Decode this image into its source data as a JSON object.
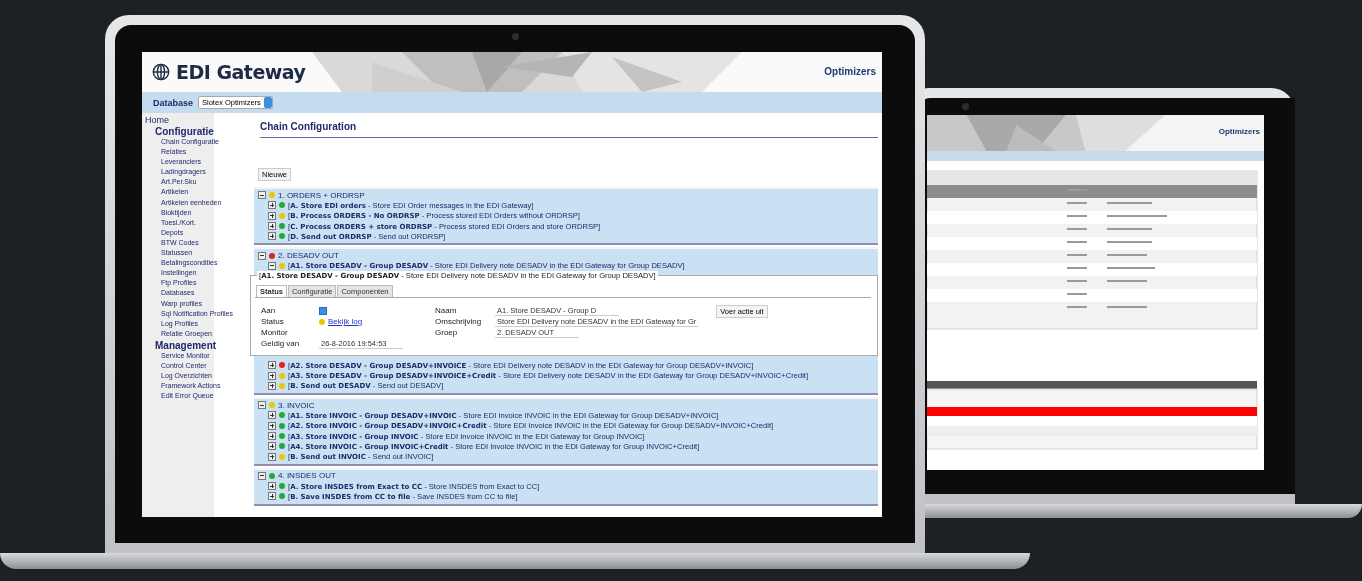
{
  "header": {
    "title": "EDI Gateway",
    "logo": "Optimizers"
  },
  "database": {
    "label": "Database",
    "value": "Slotex Optimizers"
  },
  "sidebar": {
    "items": [
      {
        "label": "Home",
        "kind": "link"
      },
      {
        "label": "Configuratie",
        "kind": "heading",
        "children": [
          {
            "label": "Chain Configuratie"
          },
          {
            "label": "Relaties"
          },
          {
            "label": "Leveranciers"
          },
          {
            "label": "Ladingdragers"
          },
          {
            "label": "Art.Per.Sku"
          },
          {
            "label": "Artikelen"
          },
          {
            "label": "Artikelen eenheden"
          },
          {
            "label": "Bloktijden"
          },
          {
            "label": "Toesl./Kort."
          },
          {
            "label": "Depots"
          },
          {
            "label": "BTW Codes"
          },
          {
            "label": "Statussen"
          },
          {
            "label": "Betalingscondities"
          },
          {
            "label": "Instellingen"
          },
          {
            "label": "Ftp Profiles"
          },
          {
            "label": "Databases"
          },
          {
            "label": "Warp profiles"
          },
          {
            "label": "Sql Notification Profiles"
          },
          {
            "label": "Log Profiles"
          },
          {
            "label": "Relatie Groepen"
          }
        ]
      },
      {
        "label": "Management",
        "kind": "heading",
        "children": [
          {
            "label": "Service Monitor"
          },
          {
            "label": "Control Center"
          },
          {
            "label": "Log Overzichten"
          },
          {
            "label": "Framework Actions"
          },
          {
            "label": "Edit Error Queue"
          }
        ]
      }
    ]
  },
  "main": {
    "title": "Chain Configuration",
    "new_button": "Nieuwe",
    "groups": [
      {
        "name": "1. ORDERS + ORDRSP",
        "color": "#e8c800",
        "expanded": true,
        "steps": [
          {
            "text": "[**A. Store EDI orders** - Store EDI Order messages in the EDI Gateway]",
            "color": "#22aa33",
            "expanded": false
          },
          {
            "text": "[**B. Process ORDERS - No ORDRSP** - Process stored EDI Orders without ORDRSP]",
            "color": "#e8c800",
            "expanded": false
          },
          {
            "text": "[**C. Process ORDERS + store ORDRSP** - Process stored EDI Orders and store ORDRSP]",
            "color": "#22aa33",
            "expanded": false
          },
          {
            "text": "[**D. Send out ORDRSP** - Send out ORDRSP]",
            "color": "#22aa33",
            "expanded": false
          }
        ]
      },
      {
        "name": "2. DESADV OUT",
        "color": "#dd2222",
        "expanded": true,
        "steps": [
          {
            "text": "[**A1. Store DESADV - Group DESADV** - Store EDI Delivery note DESADV in the EDI Gateway for Group DESADV]",
            "color": "#e8c800",
            "expanded": true,
            "detail": {
              "legend": "[**A1. Store DESADV - Group DESADV** - Store EDI Delivery note DESADV in the EDI Gateway for Group DESADV]",
              "tabs": [
                {
                  "label": "Status",
                  "selected": true
                },
                {
                  "label": "Configuratie",
                  "selected": false
                },
                {
                  "label": "Componenten",
                  "selected": false
                }
              ],
              "aan": {
                "label": "Aan",
                "checked": true
              },
              "status": {
                "label": "Status",
                "color": "#e8c800",
                "link": "Bekijk log"
              },
              "monitor": {
                "label": "Monitor"
              },
              "geldig_van": {
                "label": "Geldig van",
                "value": "26-8-2016 19:54:53"
              },
              "naam": {
                "label": "Naam",
                "value": "A1. Store DESADV - Group D"
              },
              "omschrijving": {
                "label": "Omschrijving",
                "value": "Store EDI Delivery note DESADV in the EDI Gateway for Gr"
              },
              "groep": {
                "label": "Groep",
                "value": "2. DESADV OUT"
              },
              "run_button": "Voer actie uit"
            }
          },
          {
            "text": "[**A2. Store DESADV - Group DESADV+INVOICE** - Store EDI Delivery note DESADV in the EDI Gateway for Group DESADV+INVOIC]",
            "color": "#dd2222",
            "expanded": false
          },
          {
            "text": "[**A3. Store DESADV - Group DESADV+INVOICE+Credit** - Store EDI Delivery note DESADV in the EDI Gateway for Group DESADV+INVOIC+Credit]",
            "color": "#e8c800",
            "expanded": false
          },
          {
            "text": "[**B. Send out DESADV** - Send out DESADV]",
            "color": "#e8c800",
            "expanded": false
          }
        ]
      },
      {
        "name": "3. INVOIC",
        "color": "#e8c800",
        "expanded": true,
        "steps": [
          {
            "text": "[**A1. Store INVOIC - Group DESADV+INVOIC** - Store EDI Invoice INVOIC in the EDI Gateway for Group DESADV+INVOIC]",
            "color": "#22aa33",
            "expanded": false
          },
          {
            "text": "[**A2. Store INVOIC - Group DESADV+INVOIC+Credit** - Store EDI Invoice INVOIC in the EDI Gateway for Group DESADV+INVOIC+Credit]",
            "color": "#22aa33",
            "expanded": false
          },
          {
            "text": "[**A3. Store INVOIC - Group INVOIC** - Store EDI Invoice INVOIC in the EDI Gateway for Group INVOIC]",
            "color": "#22aa33",
            "expanded": false
          },
          {
            "text": "[**A4. Store INVOIC - Group INVOIC+Credit** - Store EDI Invoice INVOIC in the EDI Gateway for Group INVOIC+Credit]",
            "color": "#22aa33",
            "expanded": false
          },
          {
            "text": "[**B. Send out INVOIC** - Send out INVOIC]",
            "color": "#e8c800",
            "expanded": false
          }
        ]
      },
      {
        "name": "4. INSDES OUT",
        "color": "#22aa33",
        "expanded": true,
        "steps": [
          {
            "text": "[**A. Store INSDES from Exact to CC** - Store INSDES from Exact to CC]",
            "color": "#22aa33",
            "expanded": false
          },
          {
            "text": "[**B. Save INSDES from CC to file** - Save INSDES from CC to file]",
            "color": "#22aa33",
            "expanded": false
          }
        ]
      }
    ]
  },
  "second_screen": {
    "logo": "Optimizers"
  }
}
